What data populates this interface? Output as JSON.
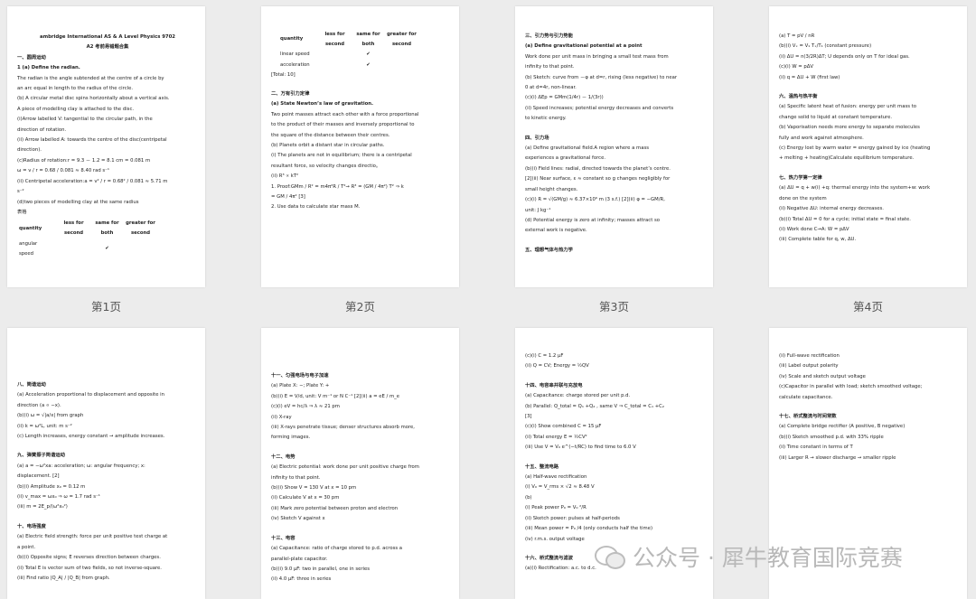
{
  "pages": [
    {
      "label": "第1页",
      "lines": [
        {
          "t": "ambridge International AS & A Level Physics 9702",
          "s": "bc"
        },
        {
          "t": "A2 考前易错题合集",
          "s": "bc"
        },
        {
          "t": "一、圆周运动",
          "s": "b"
        },
        {
          "t": "1 (a) Define the radian.",
          "s": "b"
        },
        {
          "t": "The radian is the angle subtended at the centre of a circle by"
        },
        {
          "t": "an arc equal in length to the radius of the circle."
        },
        {
          "t": "(b) A circular metal disc spins horizontally about a vertical axis."
        },
        {
          "t": "A piece of modelling clay is attached to the disc."
        },
        {
          "t": "(i)Arrow labelled V: tangential to the circular path, in the"
        },
        {
          "t": "direction of rotation."
        },
        {
          "t": "(ii) Arrow labelled A: towards the centre of the disc(centripetal"
        },
        {
          "t": "direction)."
        },
        {
          "t": "(c)Radius of rotation:r = 9.3 － 1.2 = 8.1 cm = 0.081 m"
        },
        {
          "t": "  ω = v / r = 0.68 / 0.081 ≈ 8.40 rad s⁻¹"
        },
        {
          "t": "(ii) Centripetal acceleration:a = v² / r = 0.68² / 0.081 ≈ 5.71 m"
        },
        {
          "t": "s⁻²"
        },
        {
          "t": "(d)two pieces of modelling clay at the same radius"
        },
        {
          "t": "表格"
        }
      ],
      "table": {
        "headers": [
          "quantity",
          "less for second",
          "same for both",
          "greater for second"
        ],
        "rows": [
          {
            "q": "angular speed",
            "col": "same for both"
          }
        ]
      }
    },
    {
      "label": "第2页",
      "table": {
        "headers": [
          "quantity",
          "less for second",
          "same for both",
          "greater for second"
        ],
        "rows": [
          {
            "q": "linear speed",
            "col": "same for both"
          },
          {
            "q": "acceleration",
            "col": "same for both"
          }
        ]
      },
      "mark": "✔",
      "lines": [
        {
          "t": "[Total: 10]"
        },
        {
          "t": "二、万有引力定律",
          "s": "bg"
        },
        {
          "t": "(a) State Newton’s law of gravitation.",
          "s": "b"
        },
        {
          "t": "Two point masses attract each other with a force proportional"
        },
        {
          "t": "to the product of their masses and inversely proportional to"
        },
        {
          "t": "the square of the distance between their centres."
        },
        {
          "t": "(b) Planets orbit a distant star in circular paths."
        },
        {
          "t": "(i) The planets are not in equilibrium; there is a centripetal"
        },
        {
          "t": "resultant force, so velocity changes directio。"
        },
        {
          "t": "(ii) R³ ∝ kT²"
        },
        {
          "t": "1.     Proof:GMm / R² = m4π²R / T²→ R³ = (GM / 4π²) T² ⇒ k"
        },
        {
          "t": "    = GM / 4π²  [3]"
        },
        {
          "t": "2.     Use data to calculate star mass M."
        }
      ]
    },
    {
      "label": "第3页",
      "lines": [
        {
          "t": "三、引力势与引力势能",
          "s": "b"
        },
        {
          "t": "(a) Define gravitational potential at a point",
          "s": "b"
        },
        {
          "t": "Work done per unit mass in bringing a small test mass from"
        },
        {
          "t": "infinity to that point."
        },
        {
          "t": "(b) Sketch: curve from －φ at d=r, rising (less negative) to near"
        },
        {
          "t": "0 at d=4r, non-linear."
        },
        {
          "t": "(c)(i)  ΔEp = GMm(1/4r) － 1/(3r))"
        },
        {
          "t": "(ii) Speed increases; potential energy decreases and converts"
        },
        {
          "t": "to kinetic energy."
        },
        {
          "t": "四、引力场",
          "s": "bg"
        },
        {
          "t": "(a) Define gravitational field.A region where a mass"
        },
        {
          "t": "experiences a gravitational force."
        },
        {
          "t": "(b)(i) Field lines: radial, directed towards the planet’s centre."
        },
        {
          "t": "[2](ii) Near surface, ε ≈ constant so g changes negligibly for"
        },
        {
          "t": "small height changes."
        },
        {
          "t": "(c)(i) R = √(GM/g) ≈ 6.37×10⁶ m (3 s.f.) [2](ii) φ = −GM/R,"
        },
        {
          "t": "unit: J kg⁻¹"
        },
        {
          "t": "(d) Potential energy is zero at infinity; masses attract so"
        },
        {
          "t": "external work is negative."
        },
        {
          "t": "五、理想气体与热力学",
          "s": "bg"
        }
      ]
    },
    {
      "label": "第4页",
      "lines": [
        {
          "t": "(a) T = pV / nR"
        },
        {
          "t": "(b)(i) Vₓ = V₁ Tₓ/T₁   (constant pressure)"
        },
        {
          "t": "(ii) ΔU = n(3/2R)ΔT; U depends only on T for ideal gas."
        },
        {
          "t": "(c)(i) W = pΔV"
        },
        {
          "t": "(ii) q = ΔU + W (first law)"
        },
        {
          "t": "六、温热与热平衡",
          "s": "bg"
        },
        {
          "t": "(a) Specific latent heat of fusion: energy per unit mass to"
        },
        {
          "t": "change solid to liquid at constant temperature."
        },
        {
          "t": "(b) Vaporisation needs more energy to separate molecules"
        },
        {
          "t": "fully and work against atmosphere."
        },
        {
          "t": "(c) Energy lost by warm water = energy gained by ice (heating"
        },
        {
          "t": "+ melting + heating)Calculate equilibrium temperature."
        },
        {
          "t": "七、热力学第一定律",
          "s": "bg"
        },
        {
          "t": "(a)  ΔU = q + w(i) +q: thermal energy into the system+w: work"
        },
        {
          "t": "done on the system"
        },
        {
          "t": "(ii) Negative  ΔU: internal energy decreases."
        },
        {
          "t": "(b)(i) Total ΔU = 0 for a cycle; initial state = final state."
        },
        {
          "t": "(ii) Work done C→A: W = pΔV"
        },
        {
          "t": "(iii) Complete table for q, w, ΔU."
        }
      ]
    },
    {
      "label": "第5页",
      "lines": [
        {
          "t": "八、简谐运动",
          "s": "bg"
        },
        {
          "t": "(a) Acceleration proportional to displacement and opposite in"
        },
        {
          "t": "direction (a ∝ −x)."
        },
        {
          "t": "(b)(i)  ω = √|a/x| from graph"
        },
        {
          "t": "(ii) k = ω²L, unit: m s⁻²"
        },
        {
          "t": "(c) Length increases, energy constant → amplitude increases."
        },
        {
          "t": "九、弹簧振子简谐运动",
          "s": "bg"
        },
        {
          "t": "(a) a = −ω²xa: acceleration; ω: angular frequency; x:"
        },
        {
          "t": "displacement. [2]"
        },
        {
          "t": "(b)(i) Amplitude x₀ = 0.12 m"
        },
        {
          "t": "(ii) v_max = ωx₀ ⇒ ω = 1.7 rad s⁻¹"
        },
        {
          "t": "(iii) m = 2E_p/(ω²x₀²)"
        },
        {
          "t": "十、电场强度",
          "s": "bg"
        },
        {
          "t": "(a) Electric field strength: force per unit positive test charge at"
        },
        {
          "t": "a point."
        },
        {
          "t": "(b)(i) Opposite signs; E reverses direction between charges."
        },
        {
          "t": "(ii) Total E is vector sum of two fields, so not inverse-square."
        },
        {
          "t": "(iii) Find ratio |Q_A| / |Q_B| from graph."
        }
      ]
    },
    {
      "label": "第6页",
      "lines": [
        {
          "t": "十一、匀强电场与电子加速",
          "s": "bg"
        },
        {
          "t": "(a) Plate X: −; Plate Y: +"
        },
        {
          "t": "(b)(i) E = V/d, unit: V m⁻¹ or N C⁻¹ [2](ii) a = eE / m_e"
        },
        {
          "t": "(c)(i) eV = hc/λ ⇒ λ ≈ 21 pm"
        },
        {
          "t": "(ii) X-ray"
        },
        {
          "t": "(iii) X-rays penetrate tissue; denser structures absorb more,"
        },
        {
          "t": "forming images."
        },
        {
          "t": "十二、电势",
          "s": "bg"
        },
        {
          "t": "(a) Electric potential: work done per unit positive charge from"
        },
        {
          "t": "infinity to that point."
        },
        {
          "t": "(b)(i) Show V = 130 V at x = 10 pm"
        },
        {
          "t": "(ii) Calculate V at x = 30 pm"
        },
        {
          "t": "(iii) Mark zero potential between proton and electron"
        },
        {
          "t": "(iv) Sketch V against x"
        },
        {
          "t": "十三、电容",
          "s": "bg"
        },
        {
          "t": "(a) Capacitance: ratio of charge stored to p.d. across a"
        },
        {
          "t": "parallel-plate capacitor."
        },
        {
          "t": "(b)(i) 9.0 μF: two in parallel, one in series"
        },
        {
          "t": "(ii) 4.0 μF: three in series"
        }
      ]
    },
    {
      "label": "第7页",
      "lines": [
        {
          "t": "(c)(i) C = 1.2 μF"
        },
        {
          "t": "(ii) Q = CV; Energy = ½QV"
        },
        {
          "t": "十四、电容串并联与充放电",
          "s": "bg"
        },
        {
          "t": "(a) Capacitance: charge stored per unit p.d."
        },
        {
          "t": "(b) Parallel: Q_total = Q₁ +Q₂ , same V ⇒ C_total = C₁ +C₂"
        },
        {
          "t": "[3]"
        },
        {
          "t": "(c)(i) Show combined C = 15 μF"
        },
        {
          "t": "(ii) Total energy E = ½CV²"
        },
        {
          "t": "(iii) Use V = V₀ e^(−t/RC) to find time to 6.0 V"
        },
        {
          "t": "十五、整流电路",
          "s": "bg"
        },
        {
          "t": "(a) Half-wave rectification"
        },
        {
          "t": "(i) V₀ = V_rms × √2 ≈ 8.48 V"
        },
        {
          "t": "(b)"
        },
        {
          "t": "(i) Peak power P₀ = V₀ ²/R"
        },
        {
          "t": "(ii) Sketch power: pulses at half-periods"
        },
        {
          "t": "(iii) Mean power = P₀ /4 (only conducts half the time)"
        },
        {
          "t": "(iv) r.m.s. output voltage"
        },
        {
          "t": "十六、桥式整流与滤波",
          "s": "bg"
        },
        {
          "t": "(a)(i) Rectification: a.c. to d.c."
        }
      ]
    },
    {
      "label": "第8页",
      "lines": [
        {
          "t": "(ii) Full-wave rectification"
        },
        {
          "t": "(iii) Label output polarity"
        },
        {
          "t": "(iv) Scale and sketch output voltage"
        },
        {
          "t": "(c)Capacitor in parallel with load; sketch smoothed voltage;"
        },
        {
          "t": "calculate capacitance."
        },
        {
          "t": "十七、桥式整流与时间常数",
          "s": "bg"
        },
        {
          "t": "(a) Complete bridge rectifier (A positive, B negative)"
        },
        {
          "t": "(b)(i) Sketch smoothed p.d. with 33% ripple"
        },
        {
          "t": "(ii) Time constant in terms of T"
        },
        {
          "t": "(iii) Larger R → slower discharge → smaller ripple"
        }
      ]
    }
  ],
  "watermark": "公众号 · 犀牛教育国际竞赛"
}
